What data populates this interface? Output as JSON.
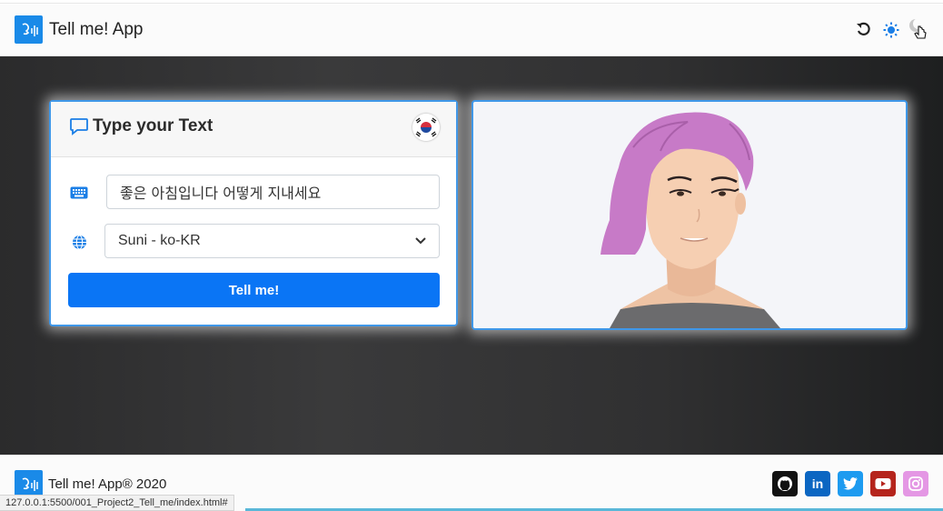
{
  "navbar": {
    "brand": "Tell me! App",
    "icons": [
      "reset-icon",
      "sun-icon",
      "moon-icon"
    ]
  },
  "text_card": {
    "title": "Type your Text",
    "input_value": "좋은 아침입니다 어떻게 지내세요",
    "voice_selected": "Suni - ko-KR",
    "button_label": "Tell me!"
  },
  "footer": {
    "copyright": "Tell me! App® 2020",
    "status_url": "127.0.0.1:5500/001_Project2_Tell_me/index.html#",
    "socials": [
      "github",
      "linkedin",
      "twitter",
      "youtube",
      "instagram"
    ]
  },
  "colors": {
    "accent": "#0a75f5",
    "card_border": "#3f97e8",
    "logo": "#1a8ae8"
  }
}
